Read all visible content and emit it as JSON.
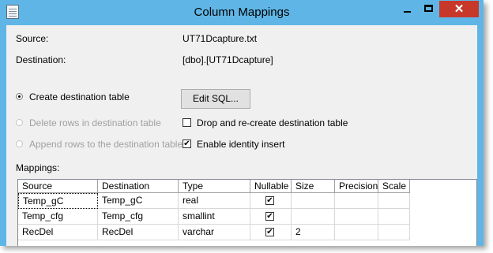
{
  "window": {
    "title": "Column Mappings",
    "close_glyph": "✕"
  },
  "source": {
    "label": "Source:",
    "value": "UT71Dcapture.txt"
  },
  "destination": {
    "label": "Destination:",
    "value": "[dbo].[UT71Dcapture]"
  },
  "options": {
    "create_label": "Create destination table",
    "delete_label": "Delete rows in destination table",
    "append_label": "Append rows to the destination table",
    "selected": "create",
    "edit_sql_label": "Edit SQL...",
    "drop_recreate_label": "Drop and re-create destination table",
    "drop_recreate_checked": false,
    "identity_insert_label": "Enable identity insert",
    "identity_insert_checked": true
  },
  "mappings": {
    "label": "Mappings:",
    "columns": [
      "Source",
      "Destination",
      "Type",
      "Nullable",
      "Size",
      "Precision",
      "Scale"
    ],
    "rows": [
      {
        "source": "Temp_gC",
        "destination": "Temp_gC",
        "type": "real",
        "nullable": true,
        "size": "",
        "precision": "",
        "scale": ""
      },
      {
        "source": "Temp_cfg",
        "destination": "Temp_cfg",
        "type": "smallint",
        "nullable": true,
        "size": "",
        "precision": "",
        "scale": ""
      },
      {
        "source": "RecDel",
        "destination": "RecDel",
        "type": "varchar",
        "nullable": true,
        "size": "2",
        "precision": "",
        "scale": ""
      }
    ]
  },
  "colors": {
    "titlebar": "#5fb6e6",
    "close": "#c7382b",
    "client": "#f0f0f0"
  }
}
